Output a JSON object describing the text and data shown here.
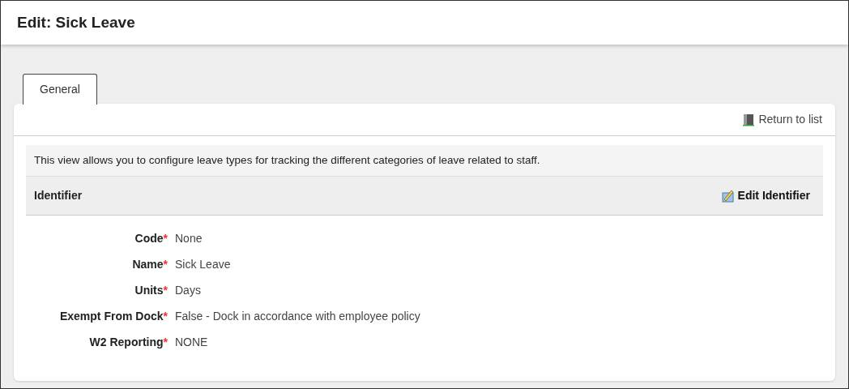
{
  "page_title": "Edit: Sick Leave",
  "tabs": [
    {
      "label": "General",
      "selected": true
    }
  ],
  "return_link": "Return to list",
  "description": "This view allows you to configure leave types for tracking the different categories of leave related to staff.",
  "section": {
    "title": "Identifier",
    "action": "Edit Identifier"
  },
  "fields": [
    {
      "label": "Code",
      "required_mark": "*",
      "value": "None"
    },
    {
      "label": "Name",
      "required_mark": "*",
      "value": "Sick Leave"
    },
    {
      "label": "Units",
      "required_mark": "*",
      "value": "Days"
    },
    {
      "label": "Exempt From Dock",
      "required_mark": "*",
      "value": "False - Dock in accordance with employee policy"
    },
    {
      "label": "W2 Reporting",
      "required_mark": "*",
      "value": "NONE"
    }
  ]
}
